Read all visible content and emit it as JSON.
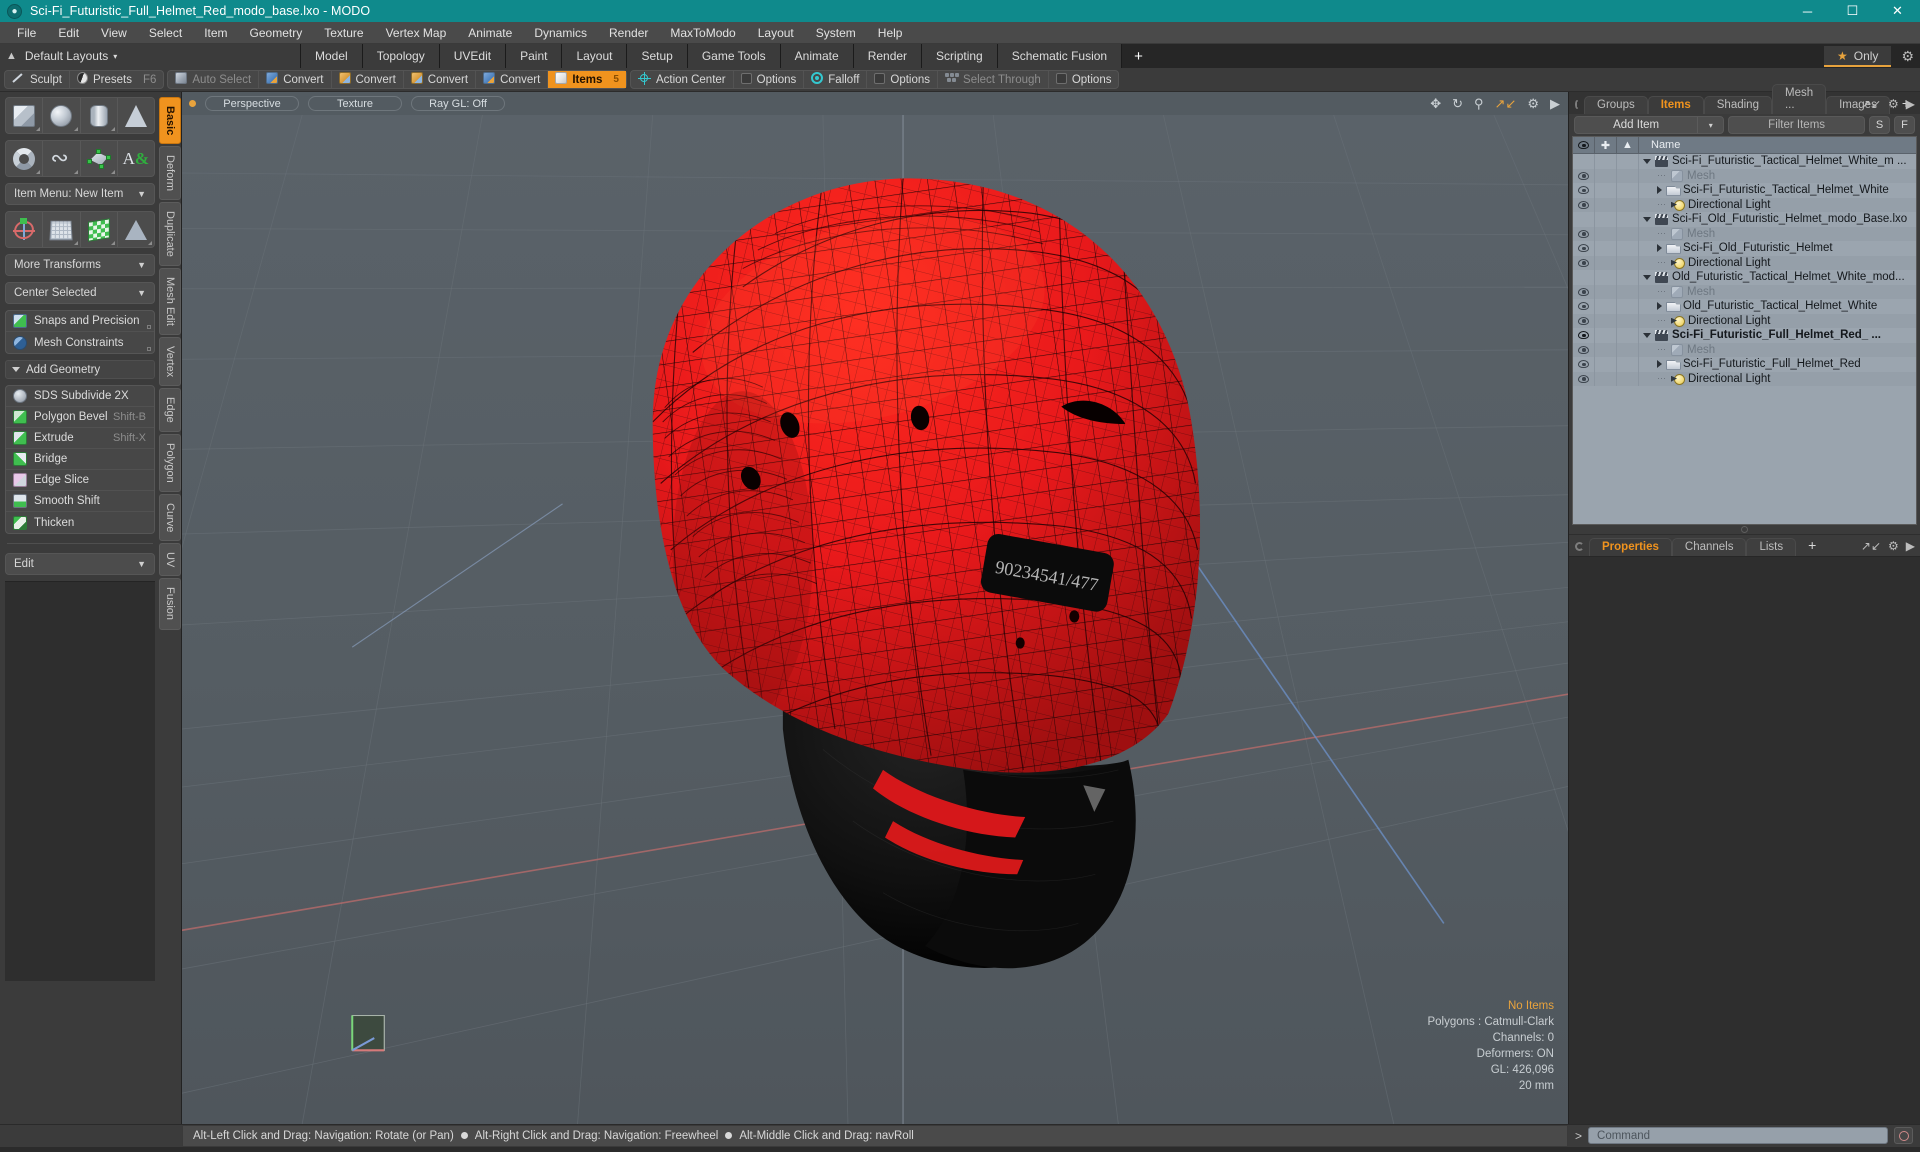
{
  "titlebar": {
    "title": "Sci-Fi_Futuristic_Full_Helmet_Red_modo_base.lxo - MODO",
    "app_icon": "modo-logo-icon",
    "minimize": "─",
    "maximize": "☐",
    "close": "✕",
    "bg": "#0f8a8c"
  },
  "menubar": {
    "items": [
      "File",
      "Edit",
      "View",
      "Select",
      "Item",
      "Geometry",
      "Texture",
      "Vertex Map",
      "Animate",
      "Dynamics",
      "Render",
      "MaxToModo",
      "Layout",
      "System",
      "Help"
    ]
  },
  "layout_row": {
    "home_icon": "home-icon",
    "default_layouts": "Default Layouts",
    "caret": "▾",
    "tabs": [
      "Model",
      "Topology",
      "UVEdit",
      "Paint",
      "Layout",
      "Setup",
      "Game Tools",
      "Animate",
      "Render",
      "Scripting",
      "Schematic Fusion"
    ],
    "add_tab": "+",
    "only_star": "★",
    "only_label": "Only",
    "gear": "⚙",
    "accent": "#e8a33d"
  },
  "optionbar": {
    "groups": [
      {
        "items": [
          {
            "label": "Sculpt",
            "icon": "pen-icon",
            "state": "normal"
          },
          {
            "label": "Presets",
            "icon": "presets-icon",
            "state": "normal",
            "shortcut": "F6"
          }
        ]
      },
      {
        "items": [
          {
            "label": "Auto Select",
            "icon": "cube-grey-icon",
            "state": "disabled"
          },
          {
            "label": "Convert",
            "icon": "cube-blue-icon",
            "state": "normal"
          },
          {
            "label": "Convert",
            "icon": "cube-orange-icon",
            "state": "normal"
          },
          {
            "label": "Convert",
            "icon": "cube-orange2-icon",
            "state": "normal"
          },
          {
            "label": "Convert",
            "icon": "cube-blue2-icon",
            "state": "normal"
          },
          {
            "label": "Items",
            "icon": "cube-white-icon",
            "state": "active",
            "badge": "5"
          }
        ]
      },
      {
        "items": [
          {
            "label": "Action Center",
            "icon": "action-center-icon",
            "state": "normal"
          },
          {
            "label": "Options",
            "icon": "options-square-icon",
            "state": "normal"
          },
          {
            "label": "Falloff",
            "icon": "falloff-icon",
            "state": "normal"
          },
          {
            "label": "Options",
            "icon": "options-square-icon",
            "state": "normal"
          },
          {
            "label": "Select Through",
            "icon": "select-through-icon",
            "state": "disabled"
          },
          {
            "label": "Options",
            "icon": "options-square-icon",
            "state": "normal"
          }
        ]
      }
    ]
  },
  "left_panel": {
    "vertical_tabs": [
      "Basic",
      "Deform",
      "Duplicate",
      "Mesh Edit",
      "Vertex",
      "Edge",
      "Polygon",
      "Curve",
      "UV",
      "Fusion"
    ],
    "active_vertical_tab": "Basic",
    "primitive_row_1": [
      {
        "name": "cube-primitive",
        "shape": "cube"
      },
      {
        "name": "sphere-primitive",
        "shape": "sphere"
      },
      {
        "name": "cylinder-primitive",
        "shape": "cylinder"
      },
      {
        "name": "cone-primitive",
        "shape": "cone"
      }
    ],
    "primitive_row_2": [
      {
        "name": "torus-primitive",
        "shape": "torus"
      },
      {
        "name": "tube-primitive",
        "shape": "tube"
      },
      {
        "name": "polygon-tool",
        "shape": "polygon"
      },
      {
        "name": "text-tool",
        "shape": "text"
      }
    ],
    "item_menu": "Item Menu: New Item",
    "transform_row": [
      {
        "name": "transform-tool",
        "shape": "axis"
      },
      {
        "name": "bend-tool",
        "shape": "grid"
      },
      {
        "name": "uv-tool",
        "shape": "check"
      },
      {
        "name": "taper-tool",
        "shape": "taper"
      }
    ],
    "more_transforms": "More Transforms",
    "center_selected": "Center Selected",
    "snaps_and_precision": "Snaps and Precision",
    "mesh_constraints": "Mesh Constraints",
    "add_geometry": "Add Geometry",
    "geometry_ops": [
      {
        "label": "SDS Subdivide 2X",
        "icon": "sds-subdivide-icon",
        "shortcut": ""
      },
      {
        "label": "Polygon Bevel",
        "icon": "polygon-bevel-icon",
        "shortcut": "Shift-B"
      },
      {
        "label": "Extrude",
        "icon": "extrude-icon",
        "shortcut": "Shift-X"
      },
      {
        "label": "Bridge",
        "icon": "bridge-icon",
        "shortcut": ""
      },
      {
        "label": "Edge Slice",
        "icon": "edge-slice-icon",
        "shortcut": ""
      },
      {
        "label": "Smooth Shift",
        "icon": "smooth-shift-icon",
        "shortcut": ""
      },
      {
        "label": "Thicken",
        "icon": "thicken-icon",
        "shortcut": ""
      }
    ],
    "edit_dropdown": "Edit"
  },
  "viewport": {
    "indicator": "active-viewport-dot",
    "view_mode": "Perspective",
    "shading_mode": "Texture",
    "ray_gl": "Ray GL: Off",
    "nav_icons": [
      "pan-icon",
      "rotate-icon",
      "zoom-icon",
      "fit-icon",
      "gear-icon",
      "chevron-right-icon"
    ],
    "stats": {
      "selection": "No Items",
      "polygons": "Polygons : Catmull-Clark",
      "channels": "Channels: 0",
      "deformers": "Deformers: ON",
      "gl": "GL: 426,096",
      "grid_size": "20 mm"
    },
    "model": {
      "name": "Sci-Fi_Futuristic_Full_Helmet_Red",
      "shell_color": "#e8191b",
      "wire_color": "#1a0000",
      "visor_color": "#0a0a0a",
      "decal_text": "90234541/477",
      "background": "#555d63"
    }
  },
  "right_panel": {
    "tabs": [
      "Groups",
      "Items",
      "Shading",
      "Mesh ...",
      "Images"
    ],
    "active_tab": "Items",
    "add_tab": "+",
    "toolbar_icons": [
      "expand-icon",
      "gear-icon",
      "chevron-right-icon"
    ],
    "add_item_button": "Add Item",
    "add_item_caret": "▾",
    "filter_placeholder": "Filter Items",
    "btn_s": "S",
    "btn_f": "F",
    "columns": [
      "eye-column",
      "add-column",
      "axis-column",
      "Name"
    ],
    "name_header": "Name",
    "rows": [
      {
        "indent": 0,
        "twisty": "down",
        "icon": "scene-icon",
        "label": "Sci-Fi_Futuristic_Tactical_Helmet_White_m ...",
        "eye": false,
        "dim": false,
        "bold": false
      },
      {
        "indent": 1,
        "twisty": "none",
        "icon": "mesh-icon",
        "label": "Mesh",
        "eye": true,
        "dim": true,
        "bold": false
      },
      {
        "indent": 1,
        "twisty": "right",
        "icon": "locator-icon",
        "label": "Sci-Fi_Futuristic_Tactical_Helmet_White",
        "eye": true,
        "dim": false,
        "bold": false
      },
      {
        "indent": 1,
        "twisty": "none",
        "icon": "light-icon",
        "label": "Directional Light",
        "eye": true,
        "dim": false,
        "bold": false
      },
      {
        "indent": 0,
        "twisty": "down",
        "icon": "scene-icon",
        "label": "Sci-Fi_Old_Futuristic_Helmet_modo_Base.lxo",
        "eye": false,
        "dim": false,
        "bold": false
      },
      {
        "indent": 1,
        "twisty": "none",
        "icon": "mesh-icon",
        "label": "Mesh",
        "eye": true,
        "dim": true,
        "bold": false
      },
      {
        "indent": 1,
        "twisty": "right",
        "icon": "locator-icon",
        "label": "Sci-Fi_Old_Futuristic_Helmet",
        "eye": true,
        "dim": false,
        "bold": false
      },
      {
        "indent": 1,
        "twisty": "none",
        "icon": "light-icon",
        "label": "Directional Light",
        "eye": true,
        "dim": false,
        "bold": false
      },
      {
        "indent": 0,
        "twisty": "down",
        "icon": "scene-icon",
        "label": "Old_Futuristic_Tactical_Helmet_White_mod...",
        "eye": false,
        "dim": false,
        "bold": false
      },
      {
        "indent": 1,
        "twisty": "none",
        "icon": "mesh-icon",
        "label": "Mesh",
        "eye": true,
        "dim": true,
        "bold": false
      },
      {
        "indent": 1,
        "twisty": "right",
        "icon": "locator-icon",
        "label": "Old_Futuristic_Tactical_Helmet_White",
        "eye": true,
        "dim": false,
        "bold": false
      },
      {
        "indent": 1,
        "twisty": "none",
        "icon": "light-icon",
        "label": "Directional Light",
        "eye": true,
        "dim": false,
        "bold": false
      },
      {
        "indent": 0,
        "twisty": "down",
        "icon": "scene-icon",
        "label": "Sci-Fi_Futuristic_Full_Helmet_Red_  ...",
        "eye": true,
        "dim": false,
        "bold": true
      },
      {
        "indent": 1,
        "twisty": "none",
        "icon": "mesh-icon",
        "label": "Mesh",
        "eye": true,
        "dim": true,
        "bold": false
      },
      {
        "indent": 1,
        "twisty": "right",
        "icon": "locator-icon",
        "label": "Sci-Fi_Futuristic_Full_Helmet_Red",
        "eye": true,
        "dim": false,
        "bold": false
      },
      {
        "indent": 1,
        "twisty": "none",
        "icon": "light-icon",
        "label": "Directional Light",
        "eye": true,
        "dim": false,
        "bold": false
      }
    ],
    "bottom_tabs": [
      "Properties",
      "Channels",
      "Lists"
    ],
    "bottom_active_tab": "Properties",
    "bottom_add": "+"
  },
  "statusbar": {
    "hint_1": "Alt-Left Click and Drag: Navigation: Rotate (or Pan)",
    "hint_2": "Alt-Right Click and Drag: Navigation: Freewheel",
    "hint_3": "Alt-Middle Click and Drag: navRoll",
    "command_prompt": "&gt;",
    "command_placeholder": "Command",
    "command_value": "",
    "record_icon": "record-icon"
  }
}
